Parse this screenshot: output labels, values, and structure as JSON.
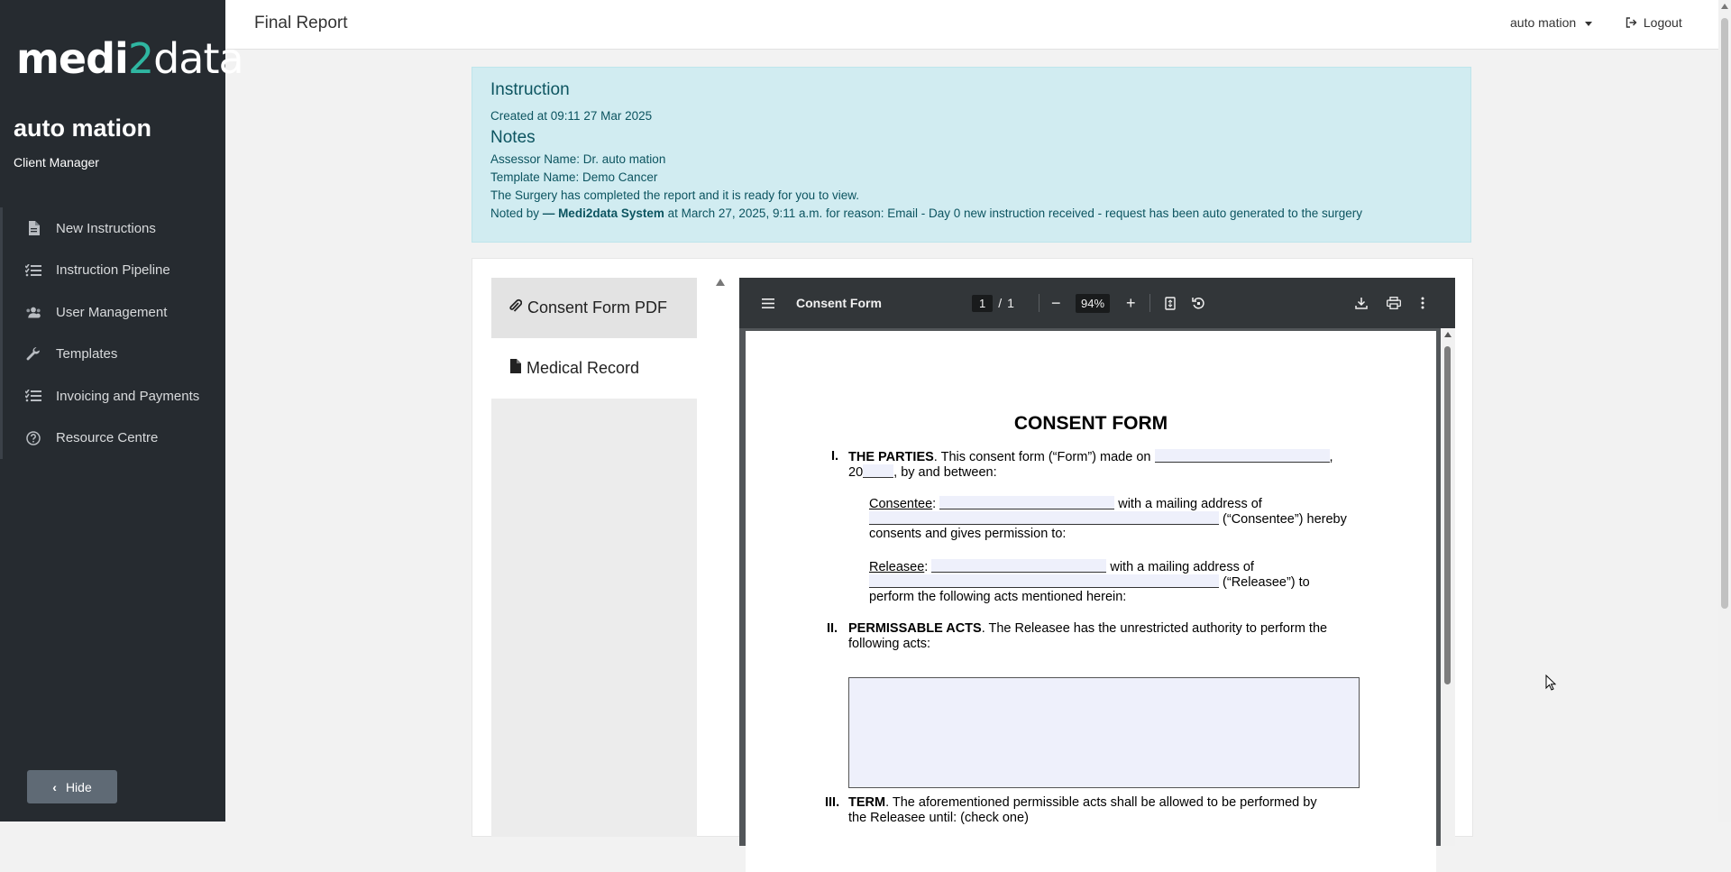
{
  "sidebar": {
    "logo": {
      "part1": "medi",
      "part2": "2",
      "part3": "data"
    },
    "user_name": "auto mation",
    "user_role": "Client Manager",
    "items": [
      {
        "label": "New Instructions",
        "icon": "document-icon"
      },
      {
        "label": "Instruction Pipeline",
        "icon": "list-check-icon"
      },
      {
        "label": "User Management",
        "icon": "users-icon"
      },
      {
        "label": "Templates",
        "icon": "wrench-icon"
      },
      {
        "label": "Invoicing and Payments",
        "icon": "list-check-icon"
      },
      {
        "label": "Resource Centre",
        "icon": "question-circle-icon"
      }
    ],
    "hide_label": "Hide"
  },
  "header": {
    "title": "Final Report",
    "user_menu": "auto mation",
    "logout": "Logout"
  },
  "instruction": {
    "heading": "Instruction",
    "created": "Created at 09:11 27 Mar 2025",
    "notes_heading": "Notes",
    "assessor": "Assessor Name: Dr. auto mation",
    "template": "Template Name: Demo Cancer",
    "status_note": "The Surgery has completed the report and it is ready for you to view.",
    "noted_prefix": "Noted by",
    "noted_by": "— Medi2data System",
    "noted_suffix": "at March 27, 2025, 9:11 a.m. for reason: Email - Day 0 new instruction received - request has been auto generated to the surgery"
  },
  "documents": {
    "tabs": [
      {
        "label": "Consent Form PDF",
        "icon": "paperclip-icon"
      },
      {
        "label": "Medical Record",
        "icon": "file-icon"
      }
    ]
  },
  "pdf_viewer": {
    "file_name": "Consent Form",
    "current_page": "1",
    "page_sep": "/",
    "total_pages": "1",
    "zoom": "94%",
    "minus": "−",
    "plus": "+"
  },
  "consent_form": {
    "title": "CONSENT FORM",
    "s1_num": "I.",
    "s1_head": "THE PARTIES",
    "s1_text": ". This consent form (“Form”) made on",
    "s1_comma": ",",
    "s1_year_prefix": "20",
    "s1_by": ", by and between:",
    "consentee_label": "Consentee",
    "colon": ":",
    "mailing": "with a mailing address of",
    "consentee_suffix": "(“Consentee”) hereby",
    "consents": "consents and gives permission to:",
    "releasee_label": "Releasee",
    "releasee_suffix": "(“Releasee”) to",
    "perform": "perform the following acts mentioned herein:",
    "s2_num": "II.",
    "s2_head": "PERMISSABLE ACTS",
    "s2_text": ". The Releasee has the unrestricted authority to perform the",
    "s2_text2": "following acts:",
    "s3_num": "III.",
    "s3_head": "TERM",
    "s3_text": ". The aforementioned permissible acts shall be allowed to be performed by",
    "s3_text2": "the Releasee until: (check one)"
  }
}
